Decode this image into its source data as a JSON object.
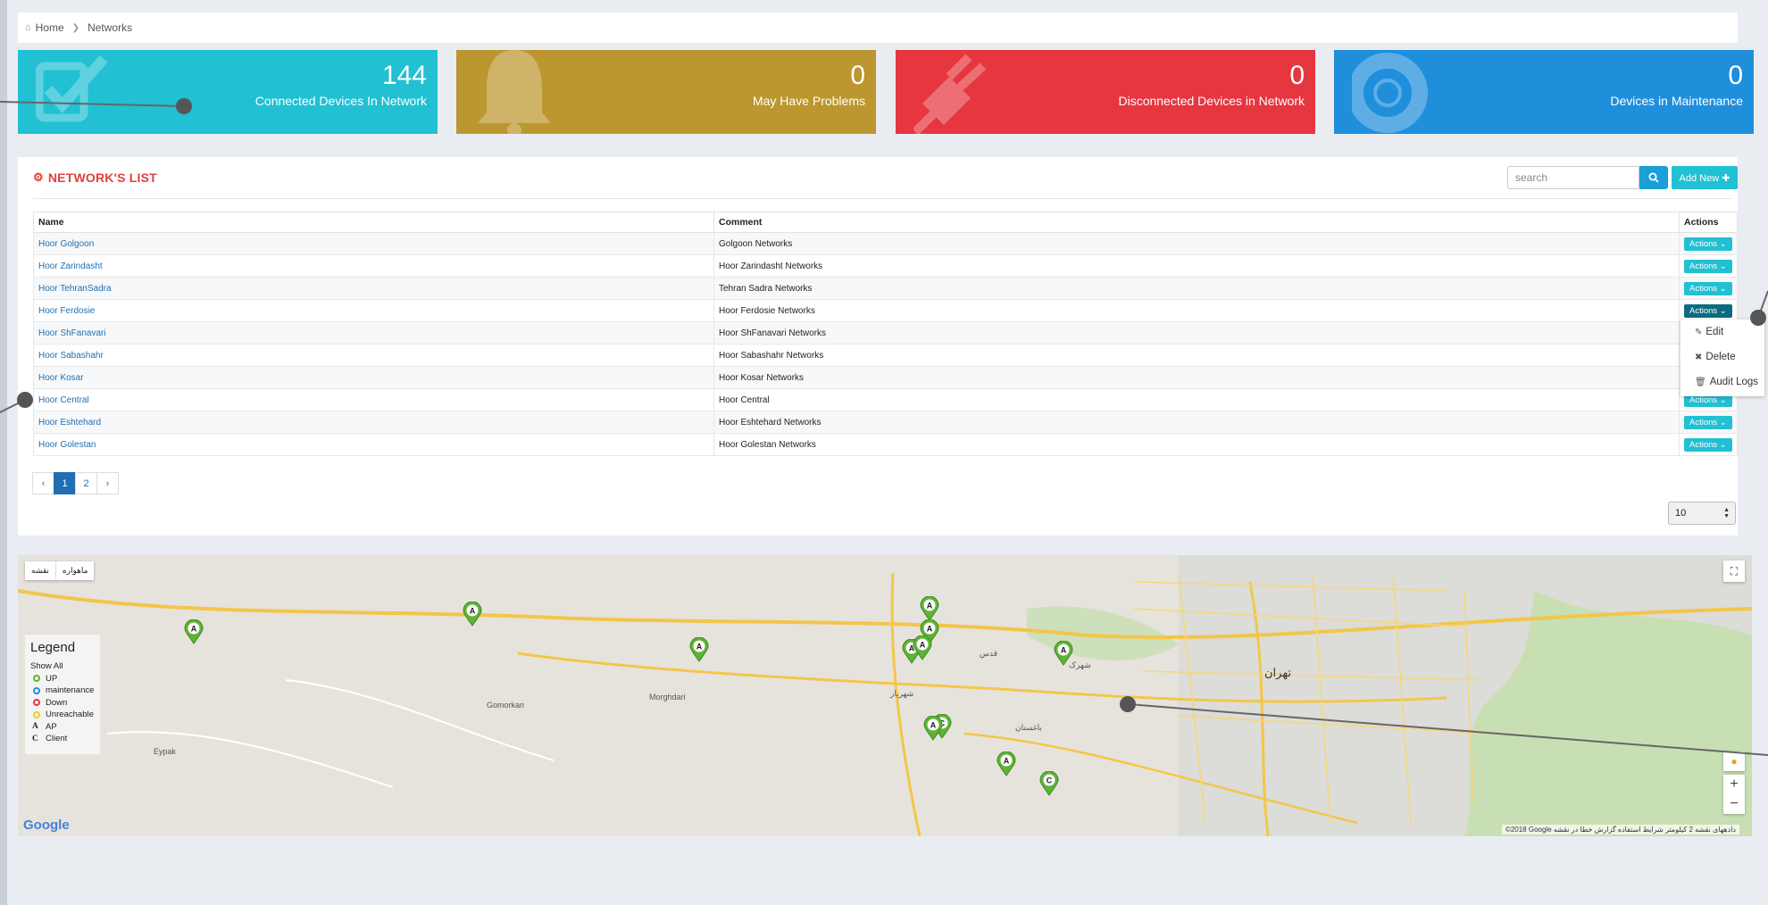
{
  "breadcrumb": {
    "home": "Home",
    "current": "Networks"
  },
  "stats": [
    {
      "value": "144",
      "label": "Connected Devices In Network",
      "color": "#21c0d3",
      "icon": "check-square-icon"
    },
    {
      "value": "0",
      "label": "May Have Problems",
      "color": "#bc962f",
      "icon": "bell-icon"
    },
    {
      "value": "0",
      "label": "Disconnected Devices in Network",
      "color": "#e6363f",
      "icon": "plug-icon"
    },
    {
      "value": "0",
      "label": "Devices in Maintenance",
      "color": "#1f8fdc",
      "icon": "life-ring-icon"
    }
  ],
  "panel": {
    "title": "NETWORK'S LIST",
    "search_placeholder": "search",
    "add_new": "Add New ✚"
  },
  "table": {
    "headers": {
      "name": "Name",
      "comment": "Comment",
      "actions": "Actions"
    },
    "action_label": "Actions ⌄",
    "rows": [
      {
        "name": "Hoor Golgoon",
        "comment": "Golgoon Networks"
      },
      {
        "name": "Hoor Zarindasht",
        "comment": "Hoor Zarindasht Networks"
      },
      {
        "name": "Hoor TehranSadra",
        "comment": "Tehran Sadra Networks"
      },
      {
        "name": "Hoor Ferdosie",
        "comment": "Hoor Ferdosie Networks"
      },
      {
        "name": "Hoor ShFanavari",
        "comment": "Hoor ShFanavari Networks"
      },
      {
        "name": "Hoor Sabashahr",
        "comment": "Hoor Sabashahr Networks"
      },
      {
        "name": "Hoor Kosar",
        "comment": "Hoor Kosar Networks"
      },
      {
        "name": "Hoor Central",
        "comment": "Hoor Central"
      },
      {
        "name": "Hoor Eshtehard",
        "comment": "Hoor Eshtehard Networks"
      },
      {
        "name": "Hoor Golestan",
        "comment": "Hoor Golestan Networks"
      }
    ]
  },
  "dropdown": {
    "edit": "Edit",
    "delete": "Delete",
    "audit": "Audit Logs"
  },
  "pagination": {
    "prev": "‹",
    "pages": [
      "1",
      "2"
    ],
    "next": "›",
    "page_size": "10"
  },
  "map": {
    "tab_map": "نقشه",
    "tab_satellite": "ماهواره",
    "legend": {
      "title": "Legend",
      "show_all": "Show All",
      "up": "UP",
      "maintenance": "maintenance",
      "down": "Down",
      "unreachable": "Unreachable",
      "ap": "AP",
      "client": "Client"
    },
    "labels": {
      "tehran": "تهران",
      "gomorkan": "Gomorkan",
      "morghdari": "Morghdari",
      "eypak": "Eypak",
      "shahriar": "شهریار",
      "baghestan": "باغستان",
      "qods": "قدس",
      "shahrak": "شهرک"
    },
    "google": "Google",
    "attribution": "©2018 Google دادههای نقشه 2 کیلومتر شرایط استفاده گزارش خطا در نقشه"
  },
  "colors": {
    "up": "#5fb336",
    "maintenance": "#1f8fdc",
    "down": "#e6363f",
    "unreachable": "#e8d12a"
  }
}
